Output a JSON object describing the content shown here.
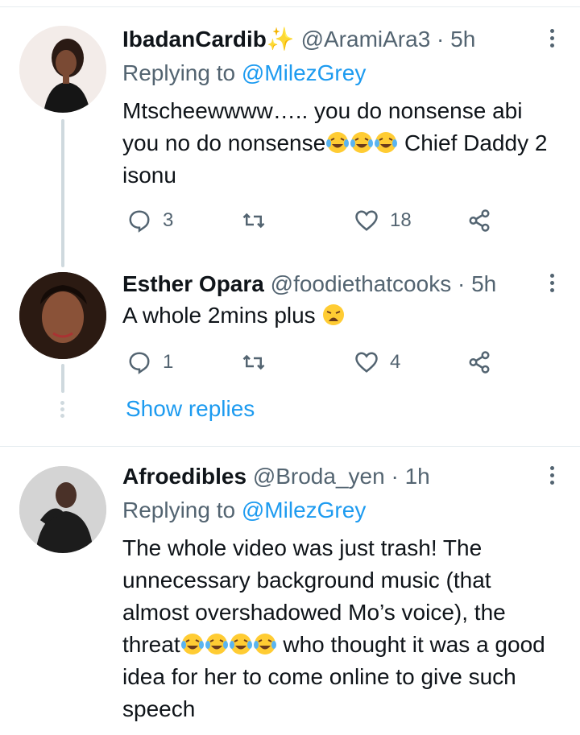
{
  "tweets": [
    {
      "name": "IbadanCardib",
      "name_emoji": "✨",
      "handle": "@AramiAra3",
      "time": "5h",
      "replying_label": "Replying to",
      "replying_to": "@MilezGrey",
      "text_1": "Mtscheewwww….. you do nonsense abi you no do nonsense",
      "text_2": " Chief Daddy 2 isonu",
      "emoji_count": 3,
      "replies": "3",
      "retweets": "",
      "likes": "18"
    },
    {
      "name": "Esther Opara",
      "handle": "@foodiethatcooks",
      "time": "5h",
      "text": "A whole 2mins plus",
      "replies": "1",
      "retweets": "",
      "likes": "4"
    },
    {
      "name": "Afroedibles",
      "handle": "@Broda_yen",
      "time": "1h",
      "replying_label": "Replying to",
      "replying_to": "@MilezGrey",
      "text_1": "The whole video was just trash! The unnecessary background music (that almost overshadowed Mo’s voice), the threat",
      "text_2": " who thought it was a good idea for her to come online to give such speech",
      "emoji_count": 4
    }
  ],
  "show_replies": "Show replies",
  "separator": " · ",
  "icons": [
    "reply-icon",
    "retweet-icon",
    "like-icon",
    "share-icon",
    "more-icon"
  ],
  "colors": {
    "link": "#1d9bf0",
    "secondary": "#536471",
    "divider": "#e6ecf0",
    "thread": "#cfd9de"
  }
}
